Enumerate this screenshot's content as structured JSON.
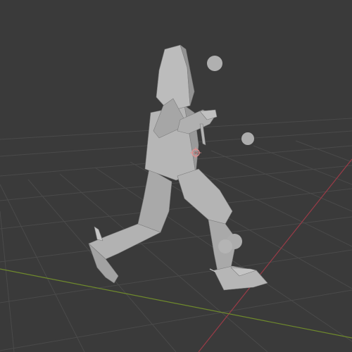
{
  "viewport": {
    "view": "perspective",
    "shading": "solid"
  },
  "colors": {
    "background": "#3a3a3a",
    "grid_line": "#4a4a4a",
    "grid_line_faint": "#434343",
    "x_axis": "#9a3b47",
    "y_axis": "#6f8a2c",
    "mesh_light": "#b9b9b9",
    "mesh_mid": "#a7a7a7",
    "mesh_dark": "#8f8f8f",
    "sphere": "#b0b0b0",
    "origin_marker": "#e09090"
  },
  "scene": {
    "object": "low-poly-humanoid-mesh",
    "spheres": 4,
    "has_3d_cursor": true
  }
}
